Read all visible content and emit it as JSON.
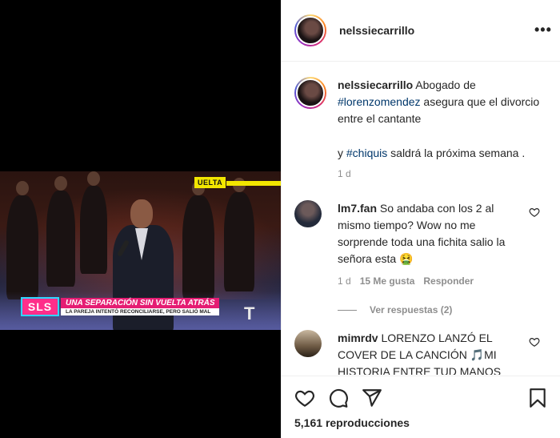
{
  "post": {
    "author": "nelssiecarrillo",
    "more_label": "•••"
  },
  "media": {
    "tag": "UELTA",
    "logo": "SLS",
    "headline": "UNA SEPARACIÓN SIN VUELTA ATRÁS",
    "subline": "LA PAREJA INTENTÓ RECONCILIARSE, PERO SALIÓ MAL",
    "network_mark": "T"
  },
  "caption": {
    "username": "nelssiecarrillo",
    "text_a": " Abogado de ",
    "hashtag_1": "#lorenzomendez",
    "text_b": " asegura que el divorcio entre el cantante",
    "text_c": "y ",
    "hashtag_2": "#chiquis",
    "text_d": " saldrá la próxima semana .",
    "time": "1 d"
  },
  "comments": [
    {
      "username": "lm7.fan",
      "text": " So andaba con los 2 al mismo tiempo? Wow no me sorprende toda una fichita salio la señora esta 🤮",
      "time": "1 d",
      "likes": "15 Me gusta",
      "reply": "Responder",
      "view_replies": "Ver respuestas (2)"
    },
    {
      "username": "mimrdv",
      "text": " LORENZO LANZÓ EL COVER DE LA CANCIÓN 🎵MI HISTORIA ENTRE TUD MANOS"
    }
  ],
  "footer": {
    "views_count": "5,161",
    "views_label": "reproducciones"
  },
  "icons": {
    "like": "heart-icon",
    "comment": "comment-icon",
    "share": "share-icon",
    "save": "bookmark-icon"
  }
}
